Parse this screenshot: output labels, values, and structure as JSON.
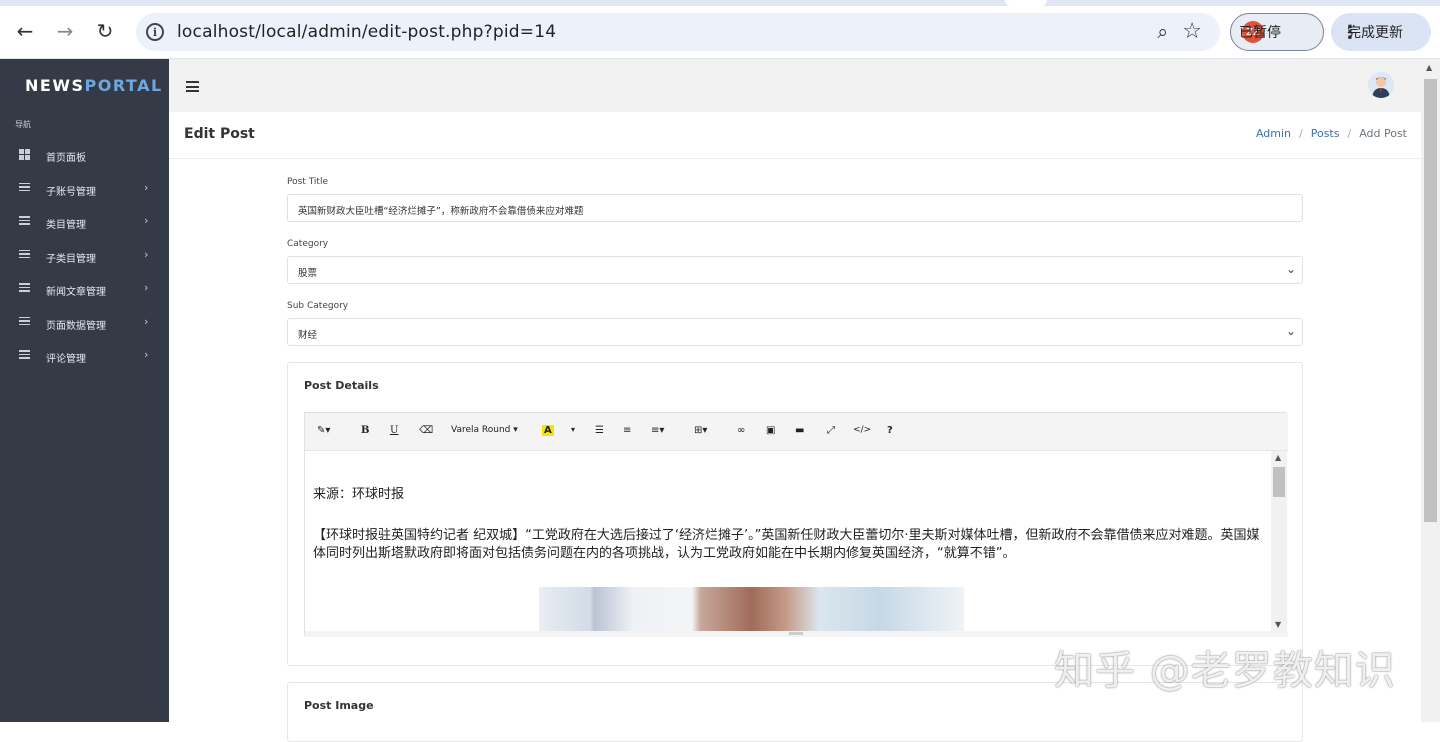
{
  "browser": {
    "url": "localhost/local/admin/edit-post.php?pid=14",
    "profile_initials": "ZZ",
    "paused_label": "已暂停",
    "update_label": "完成更新"
  },
  "sidebar": {
    "logo_part1": "NEWS",
    "logo_part2": "PORTAL",
    "nav_heading": "导航",
    "items": [
      {
        "label": "首页面板",
        "icon": "dashboard-icon"
      },
      {
        "label": "子账号管理",
        "icon": "list-icon"
      },
      {
        "label": "类目管理",
        "icon": "list-icon"
      },
      {
        "label": "子类目管理",
        "icon": "list-icon"
      },
      {
        "label": "新闻文章管理",
        "icon": "list-icon"
      },
      {
        "label": "页面数据管理",
        "icon": "list-icon"
      },
      {
        "label": "评论管理",
        "icon": "list-icon"
      }
    ]
  },
  "page": {
    "title": "Edit Post",
    "breadcrumbs": [
      "Admin",
      "Posts",
      "Add Post"
    ]
  },
  "form": {
    "post_title_label": "Post Title",
    "post_title_value": "英国新财政大臣吐槽“经济烂摊子”，称新政府不会靠借债来应对难题",
    "category_label": "Category",
    "category_value": "股票",
    "subcategory_label": "Sub Category",
    "subcategory_value": "财经",
    "details_label": "Post Details",
    "font_name": "Varela Round",
    "content_source": "来源：环球时报",
    "content_body": "【环球时报驻英国特约记者 纪双城】“工党政府在大选后接过了‘经济烂摊子’。”英国新任财政大臣蕾切尔·里夫斯对媒体吐槽，但新政府不会靠借债来应对难题。英国媒体同时列出斯塔默政府即将面对包括债务问题在内的各项挑战，认为工党政府如能在中长期内修复英国经济，“就算不错”。",
    "image_label": "Post Image"
  },
  "watermark": "知乎 @老罗教知识"
}
